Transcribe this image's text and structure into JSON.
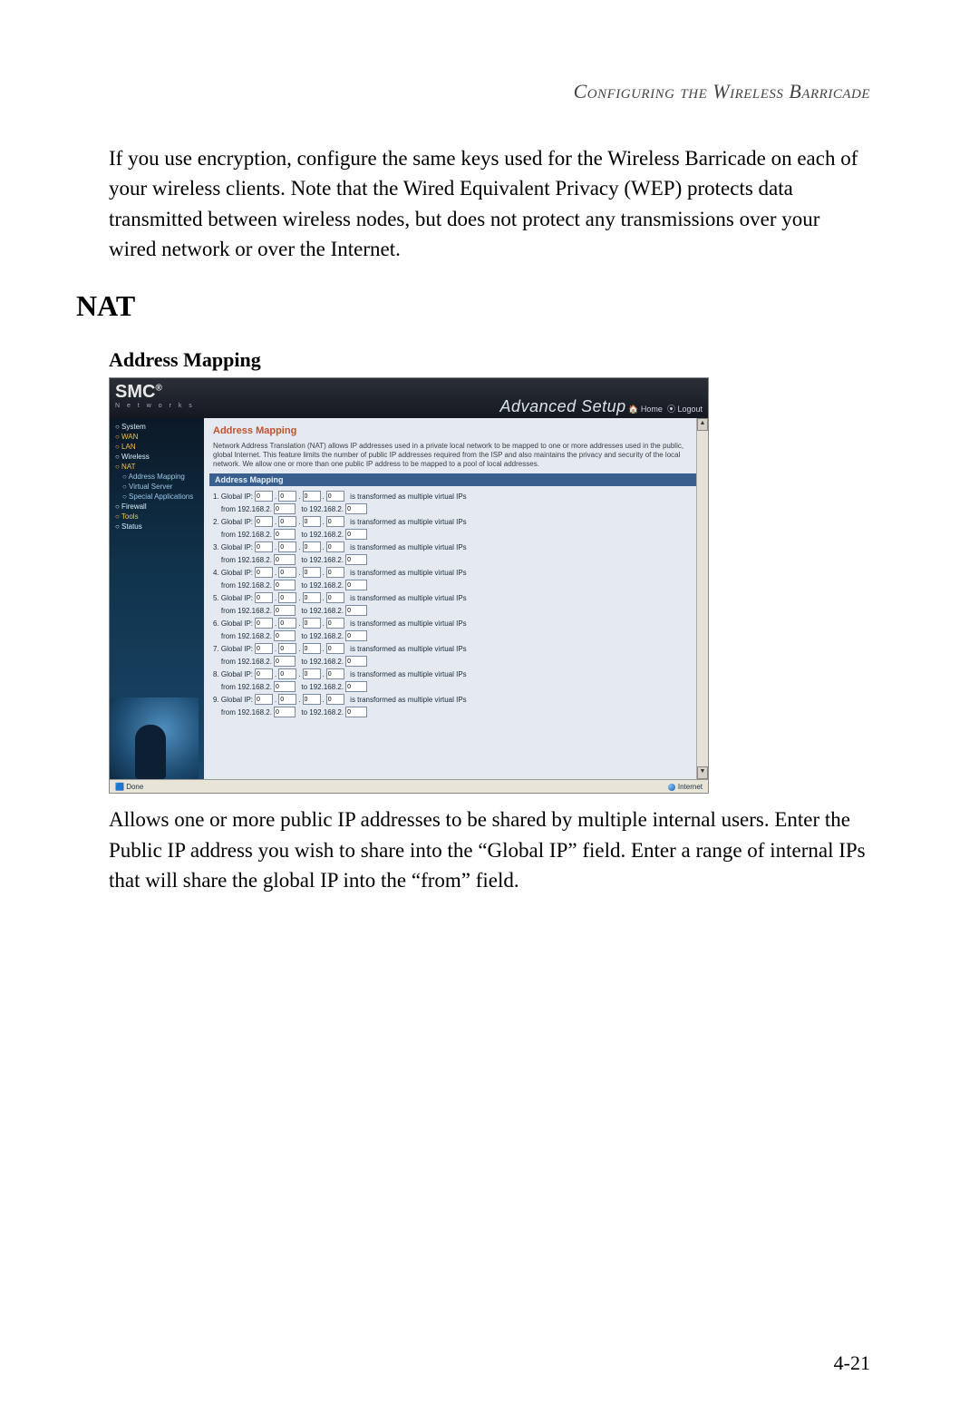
{
  "running_head": "Configuring the Wireless Barricade",
  "intro_para": "If you use encryption, configure the same keys used for the Wireless Barricade on each of your wireless clients. Note that the Wired Equivalent Privacy (WEP) protects data transmitted between wireless nodes, but does not protect any transmissions over your wired network or over the Internet.",
  "h1": "NAT",
  "h2": "Address Mapping",
  "outro_para": "Allows one or more public IP addresses to be shared by multiple internal users. Enter the Public IP address you wish to share into the “Global IP” field. Enter a range of internal IPs that will share the global IP into the “from” field.",
  "page_number": "4-21",
  "shot": {
    "brand": "SMC",
    "brand_sub": "N e t w o r k s",
    "adv": "Advanced Setup",
    "home": "Home",
    "logout": "Logout",
    "side": {
      "items": [
        {
          "label": "System",
          "cls": ""
        },
        {
          "label": "WAN",
          "cls": "sel"
        },
        {
          "label": "LAN",
          "cls": "sel"
        },
        {
          "label": "Wireless",
          "cls": ""
        },
        {
          "label": "NAT",
          "cls": "sel"
        },
        {
          "label": "Address Mapping",
          "cls": "sub sel"
        },
        {
          "label": "Virtual Server",
          "cls": "sub"
        },
        {
          "label": "Special Applications",
          "cls": "sub"
        },
        {
          "label": "Firewall",
          "cls": ""
        },
        {
          "label": "Tools",
          "cls": "sel"
        },
        {
          "label": "Status",
          "cls": ""
        }
      ]
    },
    "panel": {
      "title": "Address Mapping",
      "desc": "Network Address Translation (NAT) allows IP addresses used in a private local network to be mapped to one or more addresses used in the public, global Internet. This feature limits the number of public IP addresses required from the ISP and also maintains the privacy and security of the local network. We allow one or more than one public IP address to be mapped to a pool of local addresses.",
      "bar": "Address Mapping",
      "global_label_pre": "Global IP:",
      "transformed": "is transformed as multiple virtual IPs",
      "from_pre": "from  192.168.2.",
      "to_pre": "to 192.168.2.",
      "count": 9,
      "octet": "0",
      "range": "0"
    },
    "status": {
      "done": "Done",
      "zone": "Internet"
    }
  }
}
